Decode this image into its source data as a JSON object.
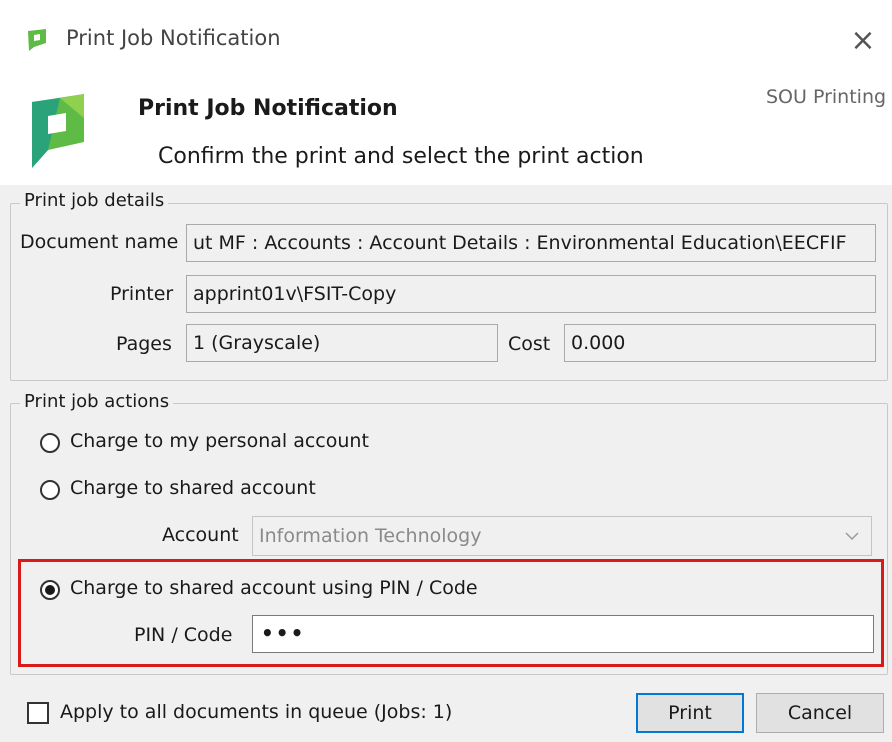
{
  "window": {
    "title": "Print Job Notification",
    "close_glyph": "×"
  },
  "header": {
    "title": "Print Job Notification",
    "subtitle": "Confirm the print and select the print action",
    "brand": "SOU Printing"
  },
  "details": {
    "legend": "Print job details",
    "document_name_label": "Document name",
    "document_name_value": "ut MF : Accounts : Account Details : Environmental Education\\EECFIF",
    "printer_label": "Printer",
    "printer_value": "apprint01v\\FSIT-Copy",
    "pages_label": "Pages",
    "pages_value": "1  (Grayscale)",
    "cost_label": "Cost",
    "cost_value": "0.000"
  },
  "actions": {
    "legend": "Print job actions",
    "options": [
      {
        "label": "Charge to my personal account",
        "selected": false
      },
      {
        "label": "Charge to shared account",
        "selected": false
      },
      {
        "label": "Charge to shared account using PIN / Code",
        "selected": true
      }
    ],
    "account_label": "Account",
    "account_value": "Information Technology",
    "pin_label": "PIN / Code",
    "pin_value": "•••"
  },
  "footer": {
    "apply_all_label": "Apply to all documents in queue (Jobs: 1)",
    "apply_all_checked": false,
    "print_button": "Print",
    "cancel_button": "Cancel"
  },
  "colors": {
    "highlight": "#d81a1a",
    "primary_button_border": "#0078d7",
    "logo_green": "#5dbb46",
    "logo_teal": "#1a8c8c"
  }
}
